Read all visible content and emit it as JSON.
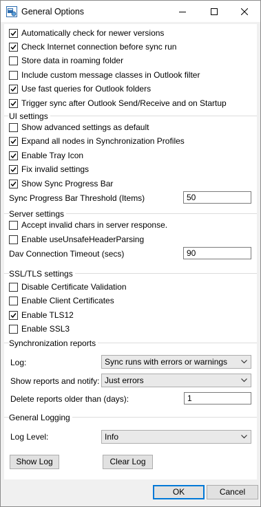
{
  "window": {
    "title": "General Options"
  },
  "general": {
    "items": [
      {
        "label": "Automatically check for newer versions",
        "checked": true
      },
      {
        "label": "Check Internet connection before sync run",
        "checked": true
      },
      {
        "label": "Store data in roaming folder",
        "checked": false
      },
      {
        "label": "Include custom message classes in Outlook filter",
        "checked": false
      },
      {
        "label": "Use fast queries for Outlook folders",
        "checked": true
      },
      {
        "label": "Trigger sync after Outlook Send/Receive and on Startup",
        "checked": true
      }
    ]
  },
  "ui_settings": {
    "title": "UI settings",
    "items": [
      {
        "label": "Show advanced settings as default",
        "checked": false
      },
      {
        "label": "Expand all nodes in Synchronization Profiles",
        "checked": true
      },
      {
        "label": "Enable Tray Icon",
        "checked": true
      },
      {
        "label": "Fix invalid settings",
        "checked": true
      },
      {
        "label": "Show Sync Progress Bar",
        "checked": true
      }
    ],
    "threshold_label": "Sync Progress Bar Threshold (Items)",
    "threshold_value": "50"
  },
  "server_settings": {
    "title": "Server settings",
    "items": [
      {
        "label": "Accept invalid chars in server response.",
        "checked": false
      },
      {
        "label": "Enable useUnsafeHeaderParsing",
        "checked": false
      }
    ],
    "timeout_label": "Dav Connection Timeout (secs)",
    "timeout_value": "90"
  },
  "ssl_tls": {
    "title": "SSL/TLS settings",
    "items": [
      {
        "label": "Disable Certificate Validation",
        "checked": false
      },
      {
        "label": "Enable Client Certificates",
        "checked": false
      },
      {
        "label": "Enable TLS12",
        "checked": true
      },
      {
        "label": "Enable SSL3",
        "checked": false
      }
    ]
  },
  "sync_reports": {
    "title": "Synchronization reports",
    "log_label": "Log:",
    "log_value": "Sync runs with errors or warnings",
    "notify_label": "Show reports and notify:",
    "notify_value": "Just errors",
    "delete_label": "Delete reports older than (days):",
    "delete_value": "1"
  },
  "general_logging": {
    "title": "General Logging",
    "level_label": "Log Level:",
    "level_value": "Info",
    "show_log": "Show Log",
    "clear_log": "Clear Log"
  },
  "footer": {
    "ok": "OK",
    "cancel": "Cancel"
  }
}
